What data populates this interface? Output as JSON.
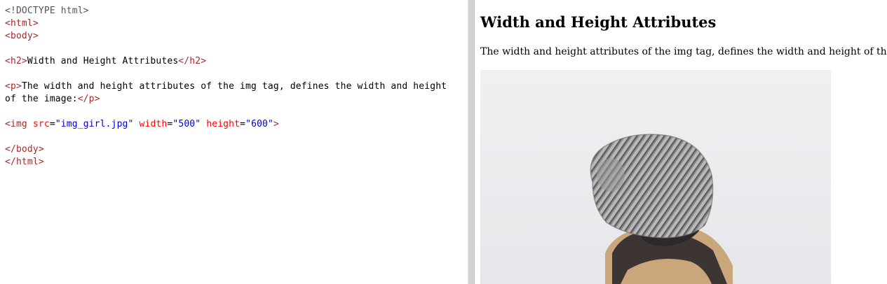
{
  "editor": {
    "code_lines": [
      [
        {
          "t": "dt",
          "v": "<!DOCTYPE html>"
        }
      ],
      [
        {
          "t": "tag",
          "v": "<html>"
        }
      ],
      [
        {
          "t": "tag",
          "v": "<body>"
        }
      ],
      [],
      [
        {
          "t": "tag",
          "v": "<h2>"
        },
        {
          "t": "txt",
          "v": "Width and Height Attributes"
        },
        {
          "t": "tag",
          "v": "</h2>"
        }
      ],
      [],
      [
        {
          "t": "tag",
          "v": "<p>"
        },
        {
          "t": "txt",
          "v": "The width and height attributes of the img tag, defines the width and height"
        }
      ],
      [
        {
          "t": "txt",
          "v": "of the image:"
        },
        {
          "t": "tag",
          "v": "</p>"
        }
      ],
      [],
      [
        {
          "t": "tag",
          "v": "<img"
        },
        {
          "t": "txt",
          "v": " "
        },
        {
          "t": "attr",
          "v": "src"
        },
        {
          "t": "txt",
          "v": "="
        },
        {
          "t": "val",
          "v": "\"img_girl.jpg\""
        },
        {
          "t": "txt",
          "v": " "
        },
        {
          "t": "attr",
          "v": "width"
        },
        {
          "t": "txt",
          "v": "="
        },
        {
          "t": "val",
          "v": "\"500\""
        },
        {
          "t": "txt",
          "v": " "
        },
        {
          "t": "attr",
          "v": "height"
        },
        {
          "t": "txt",
          "v": "="
        },
        {
          "t": "val",
          "v": "\"600\""
        },
        {
          "t": "tag",
          "v": ">"
        }
      ],
      [],
      [
        {
          "t": "tag",
          "v": "</body>"
        }
      ],
      [
        {
          "t": "tag",
          "v": "</html>"
        }
      ]
    ]
  },
  "preview": {
    "heading": "Width and Height Attributes",
    "paragraph": "The width and height attributes of the img tag, defines the width and height of the image:"
  },
  "colors": {
    "tag": "#a52a2a",
    "attribute": "#ff0000",
    "attribute_value": "#0000cd",
    "divider": "#d3d3d3"
  }
}
